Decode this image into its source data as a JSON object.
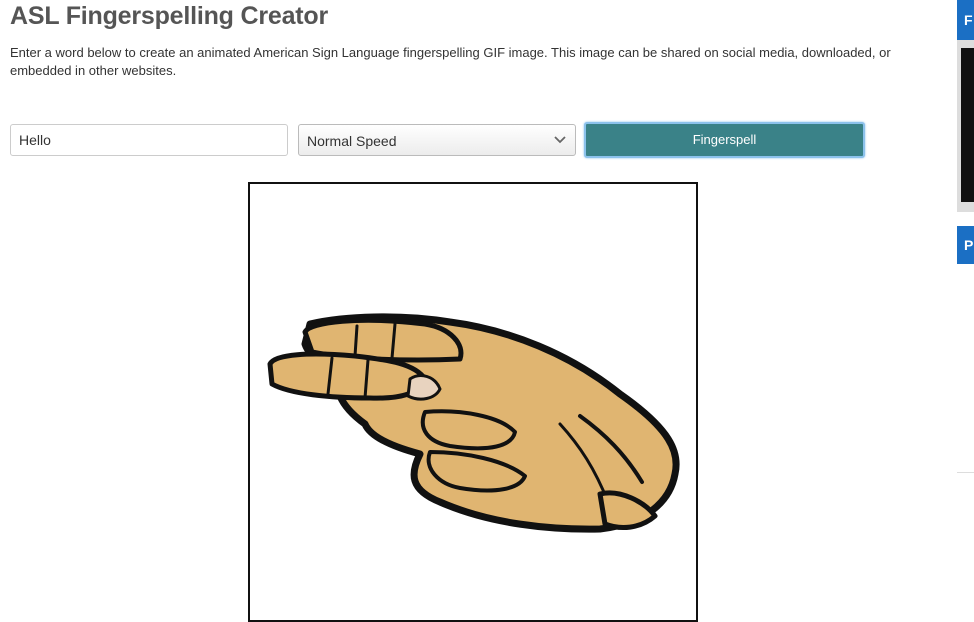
{
  "header": {
    "title": "ASL Fingerspelling Creator",
    "description": "Enter a word below to create an animated American Sign Language fingerspelling GIF image. This image can be shared on social media, downloaded, or embedded in other websites."
  },
  "form": {
    "word_value": "Hello",
    "speed_selected": "Normal Speed",
    "submit_label": "Fingerspell"
  },
  "preview": {
    "shown_letter_icon": "asl-hand-letter-h-icon"
  },
  "sidebar": {
    "widget1_tab_label": "F",
    "widget2_tab_label": "P"
  },
  "colors": {
    "button_bg": "#3a8288",
    "focus_ring": "#8cc2ec",
    "skin": "#e0b571",
    "sidebar_tab": "#1b6fc4"
  }
}
